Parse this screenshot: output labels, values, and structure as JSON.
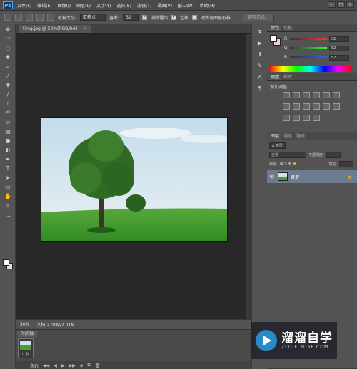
{
  "app": {
    "logo": "Ps"
  },
  "menu": [
    "文件(F)",
    "编辑(E)",
    "图像(I)",
    "图层(L)",
    "文字(Y)",
    "选择(S)",
    "滤镜(T)",
    "视图(V)",
    "窗口(W)",
    "帮助(H)"
  ],
  "window_controls": [
    "-",
    "□",
    "×"
  ],
  "options": {
    "sample_size_label": "取样大小:",
    "sample_size_value": "取样点",
    "tolerance_label": "容差:",
    "tolerance_value": "32",
    "anti_alias_label": "消除锯齿",
    "contiguous_label": "连续",
    "sample_all_layers_label": "对所有图层取样",
    "refine_edge_button": "调整边缘..."
  },
  "document": {
    "tab_title": "timg.jpg @ 50%(RGB/8#)",
    "zoom": "50%",
    "doc_info": "文档:2.01M/2.01M"
  },
  "timeline": {
    "tab": "时间轴",
    "frame_time": "0 秒",
    "loop": "永远"
  },
  "color_panel": {
    "tabs": [
      "颜色",
      "色板"
    ],
    "sliders": [
      {
        "letter": "R",
        "value": "52",
        "color": "#ff3030"
      },
      {
        "letter": "G",
        "value": "52",
        "color": "#30ff30"
      },
      {
        "letter": "B",
        "value": "52",
        "color": "#3060ff"
      }
    ]
  },
  "adjust_panel": {
    "tabs": [
      "调整",
      "样式"
    ],
    "title": "添加调整"
  },
  "layers_panel": {
    "tabs": [
      "图层",
      "通道",
      "路径"
    ],
    "filter": "ρ 类型",
    "blend_mode": "正常",
    "opacity_label": "不透明度:",
    "lock_label": "锁定:",
    "fill_label": "填充:",
    "layer_name": "背景"
  },
  "watermark": {
    "brand": "溜溜自学",
    "url": "ZIXUE.3D66.COM"
  }
}
